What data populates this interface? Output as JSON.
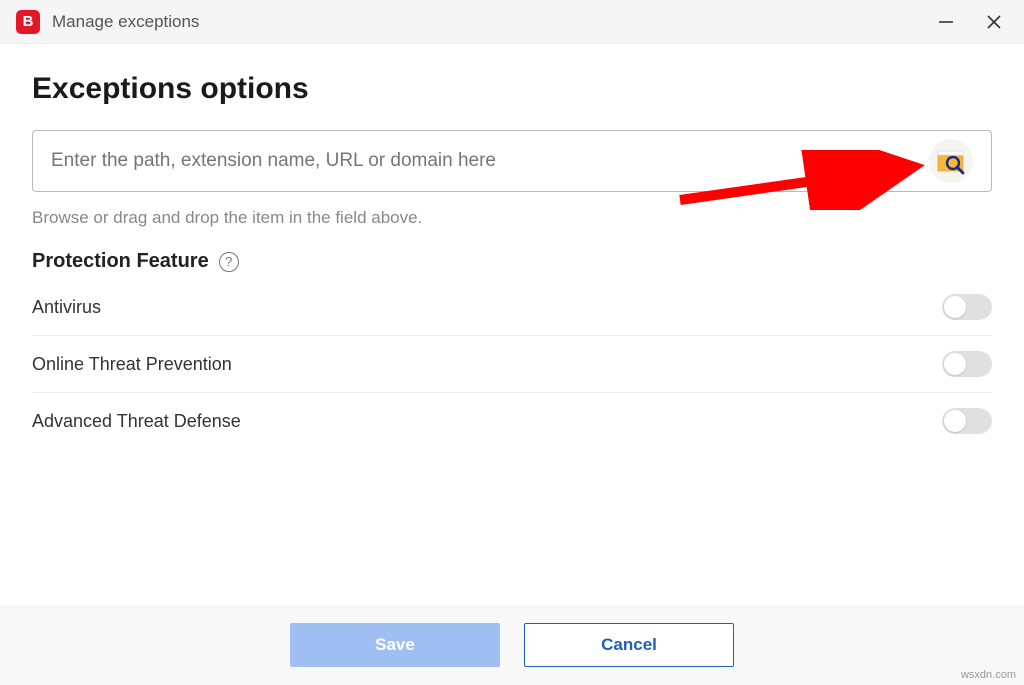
{
  "titlebar": {
    "app_letter": "B",
    "title": "Manage exceptions"
  },
  "page": {
    "heading": "Exceptions options",
    "input_placeholder": "Enter the path, extension name, URL or domain here",
    "hint": "Browse or drag and drop the item in the field above."
  },
  "section": {
    "title": "Protection Feature"
  },
  "features": [
    {
      "label": "Antivirus"
    },
    {
      "label": "Online Threat Prevention"
    },
    {
      "label": "Advanced Threat Defense"
    }
  ],
  "footer": {
    "save": "Save",
    "cancel": "Cancel"
  },
  "watermark": "wsxdn.com"
}
